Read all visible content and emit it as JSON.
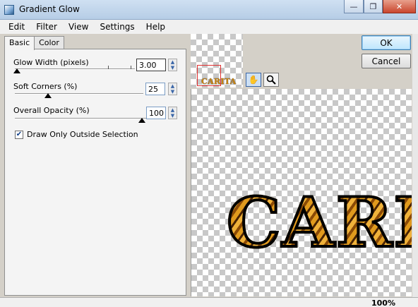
{
  "window": {
    "title": "Gradient Glow",
    "min_glyph": "—",
    "max_glyph": "❐",
    "close_glyph": "✕"
  },
  "menu": [
    "Edit",
    "Filter",
    "View",
    "Settings",
    "Help"
  ],
  "tabs": {
    "basic": "Basic",
    "color": "Color"
  },
  "controls": {
    "glow_width": {
      "label": "Glow Width (pixels)",
      "value": "3.00",
      "slider_fraction": 0.0
    },
    "soft_corners": {
      "label": "Soft Corners (%)",
      "value": "25",
      "slider_fraction": 0.25
    },
    "overall_opacity": {
      "label": "Overall Opacity (%)",
      "value": "100",
      "slider_fraction": 1.0
    },
    "draw_only_outside": {
      "label": "Draw Only Outside Selection",
      "checked": true
    }
  },
  "preview": {
    "thumb_text": "CARITA",
    "main_text": "CARI",
    "tools": [
      "hand-icon",
      "magnifier-icon"
    ]
  },
  "buttons": {
    "ok": "OK",
    "cancel": "Cancel"
  },
  "status": {
    "zoom": "100%"
  }
}
